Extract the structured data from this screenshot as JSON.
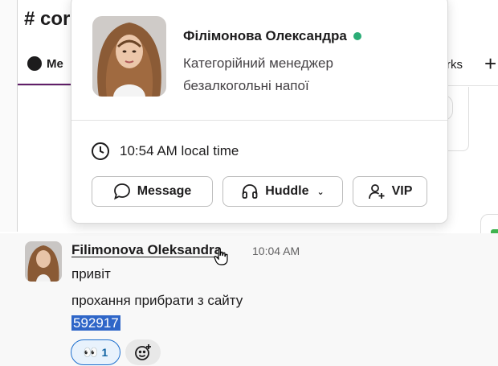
{
  "channel": {
    "title": "# cor",
    "tab_messages": "Me",
    "tab_right": "rks",
    "tab_add": "+"
  },
  "profile_card": {
    "name": "Філімонова Олександра",
    "role": "Категорійний менеджер безалкогольні напої",
    "local_time": "10:54 AM local time",
    "presence": "active",
    "buttons": {
      "message": "Message",
      "huddle": "Huddle",
      "vip": "VIP"
    }
  },
  "message": {
    "sender": "Filimonova Oleksandra",
    "time": "10:04 AM",
    "lines": [
      "привіт",
      "прохання прибрати з сайту",
      "592917"
    ],
    "reaction": {
      "emoji": "👀",
      "count": "1"
    }
  },
  "colors": {
    "presence_green": "#2bac76",
    "selection_blue": "#2f66c8",
    "reaction_border": "#1d6fce",
    "tab_underline": "#611f69"
  }
}
